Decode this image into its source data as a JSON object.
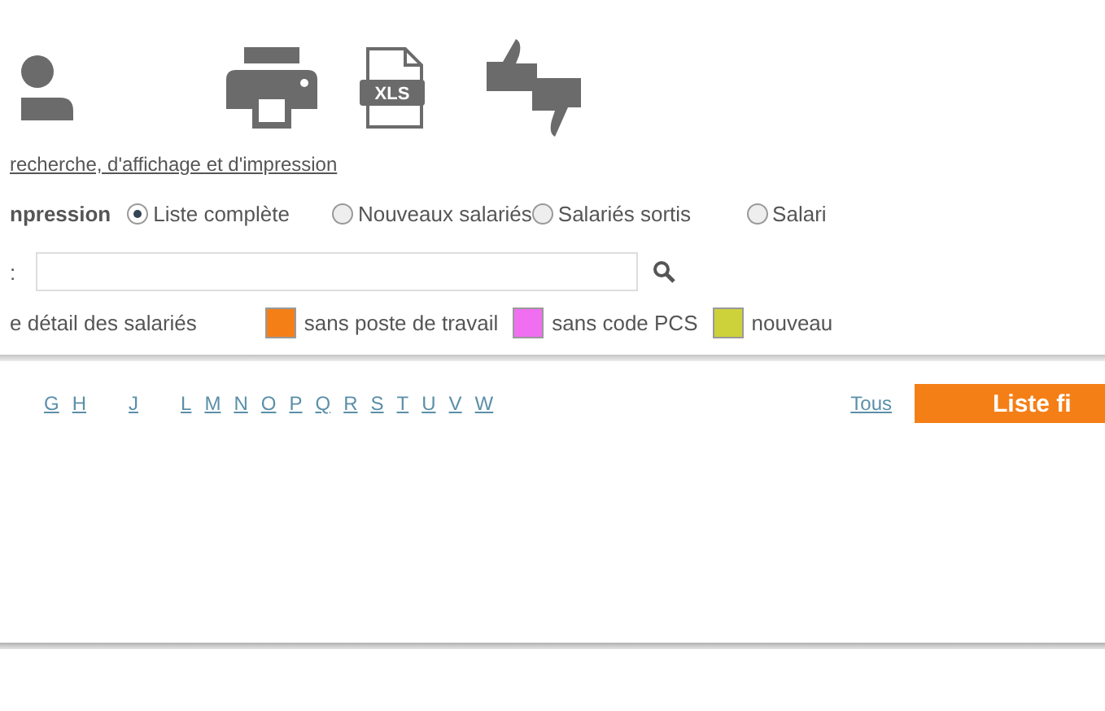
{
  "toolbar": {
    "icons": [
      {
        "kind": "person"
      },
      {
        "kind": "printer"
      },
      {
        "kind": "xls",
        "label": "XLS"
      },
      {
        "kind": "thumbs"
      }
    ]
  },
  "search_link": "recherche, d'affichage et d'impression",
  "print_options": {
    "label": "npression",
    "options": [
      {
        "label": "Liste complète",
        "selected": true
      },
      {
        "label": "Nouveaux salariés",
        "selected": false
      },
      {
        "label": "Salariés sortis",
        "selected": false
      },
      {
        "label": "Salari",
        "selected": false
      }
    ]
  },
  "search": {
    "label": ":"
  },
  "legend": {
    "label": "e détail des salariés",
    "items": [
      {
        "label": "sans poste de travail",
        "color": "#f57f17"
      },
      {
        "label": "sans code PCS",
        "color": "#f06ef0"
      },
      {
        "label": "nouveau",
        "color": "#cdd23a"
      }
    ]
  },
  "letters": [
    "G",
    "H",
    "J",
    "L",
    "M",
    "N",
    "O",
    "P",
    "Q",
    "R",
    "S",
    "T",
    "U",
    "V",
    "W"
  ],
  "all_link": "Tous",
  "list_button": "Liste fi"
}
